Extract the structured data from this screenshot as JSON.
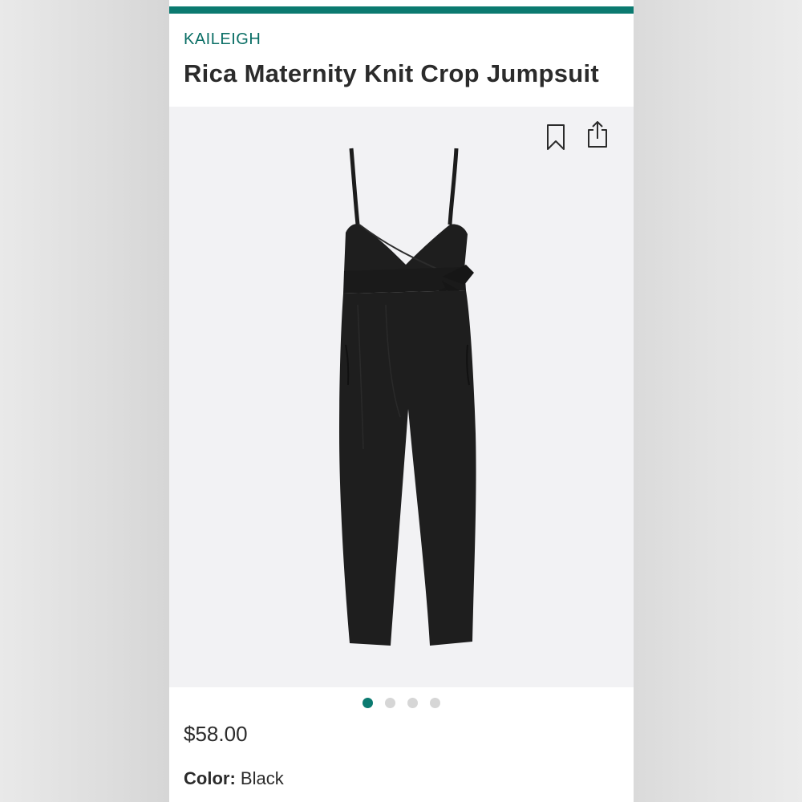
{
  "brand": {
    "name": "KAILEIGH",
    "accent_color": "#0b7a70"
  },
  "product": {
    "title": "Rica Maternity Knit Crop Jumpsuit",
    "price": "$58.00",
    "color_label": "Color:",
    "color_value": "Black",
    "image_icon": "black-jumpsuit-image"
  },
  "actions": {
    "bookmark_icon": "bookmark-icon",
    "share_icon": "share-icon"
  },
  "carousel": {
    "total": 4,
    "active_index": 0
  }
}
